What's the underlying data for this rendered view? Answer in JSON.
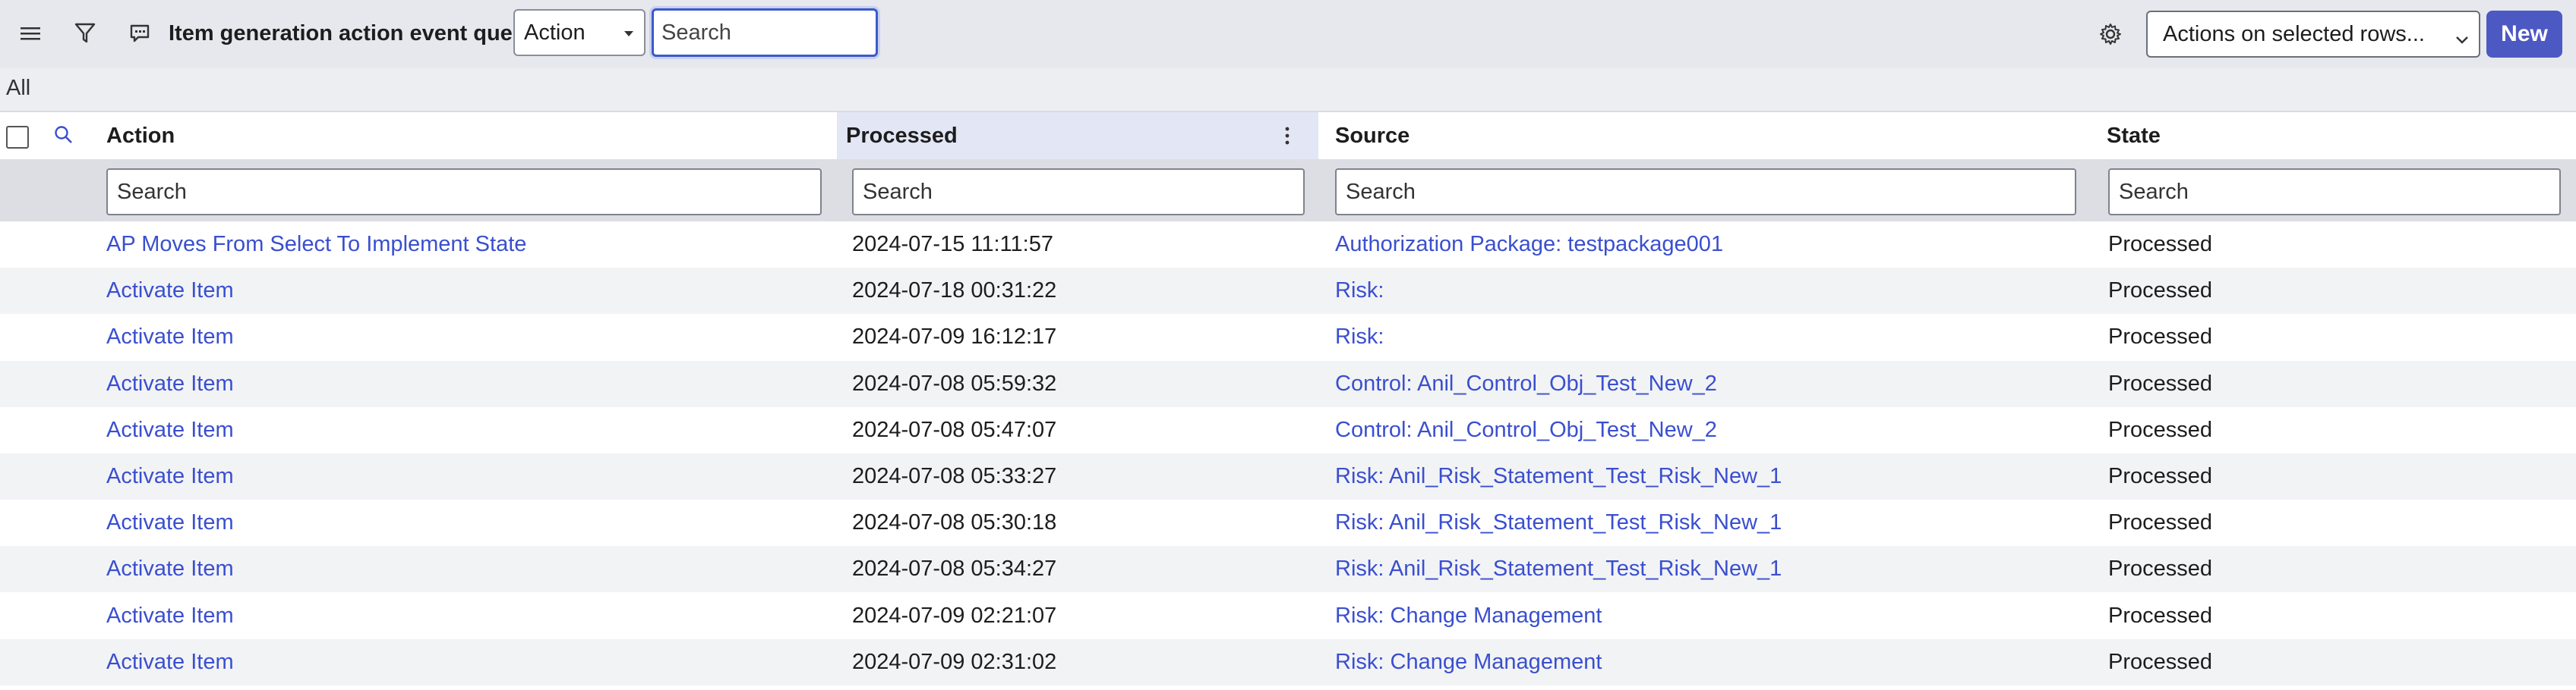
{
  "toolbar": {
    "title": "Item generation action event queue",
    "field_select_value": "Action",
    "search_placeholder": "Search",
    "actions_select_value": "Actions on selected rows...",
    "new_button_label": "New"
  },
  "breadcrumb": {
    "label": "All"
  },
  "table": {
    "columns": [
      "Action",
      "Processed",
      "Source",
      "State"
    ],
    "search_placeholder": "Search",
    "rows": [
      {
        "action": "AP Moves From Select To Implement State",
        "processed": "2024-07-15 11:11:57",
        "source": "Authorization Package: testpackage001",
        "state": "Processed"
      },
      {
        "action": "Activate Item",
        "processed": "2024-07-18 00:31:22",
        "source": "Risk:",
        "state": "Processed"
      },
      {
        "action": "Activate Item",
        "processed": "2024-07-09 16:12:17",
        "source": "Risk:",
        "state": "Processed"
      },
      {
        "action": "Activate Item",
        "processed": "2024-07-08 05:59:32",
        "source": "Control: Anil_Control_Obj_Test_New_2",
        "state": "Processed"
      },
      {
        "action": "Activate Item",
        "processed": "2024-07-08 05:47:07",
        "source": "Control: Anil_Control_Obj_Test_New_2",
        "state": "Processed"
      },
      {
        "action": "Activate Item",
        "processed": "2024-07-08 05:33:27",
        "source": "Risk: Anil_Risk_Statement_Test_Risk_New_1",
        "state": "Processed"
      },
      {
        "action": "Activate Item",
        "processed": "2024-07-08 05:30:18",
        "source": "Risk: Anil_Risk_Statement_Test_Risk_New_1",
        "state": "Processed"
      },
      {
        "action": "Activate Item",
        "processed": "2024-07-08 05:34:27",
        "source": "Risk: Anil_Risk_Statement_Test_Risk_New_1",
        "state": "Processed"
      },
      {
        "action": "Activate Item",
        "processed": "2024-07-09 02:21:07",
        "source": "Risk: Change Management",
        "state": "Processed"
      },
      {
        "action": "Activate Item",
        "processed": "2024-07-09 02:31:02",
        "source": "Risk: Change Management",
        "state": "Processed"
      }
    ]
  },
  "icons": {
    "menu": "hamburger-icon",
    "filter": "funnel-icon",
    "comment": "comment-icon",
    "gear": "gear-icon",
    "search": "search-icon",
    "column_menu": "vertical-dots-icon"
  },
  "colors": {
    "accent": "#4d59c2",
    "link": "#3a4fcf",
    "toolbar_bg": "#e6e8ee"
  }
}
